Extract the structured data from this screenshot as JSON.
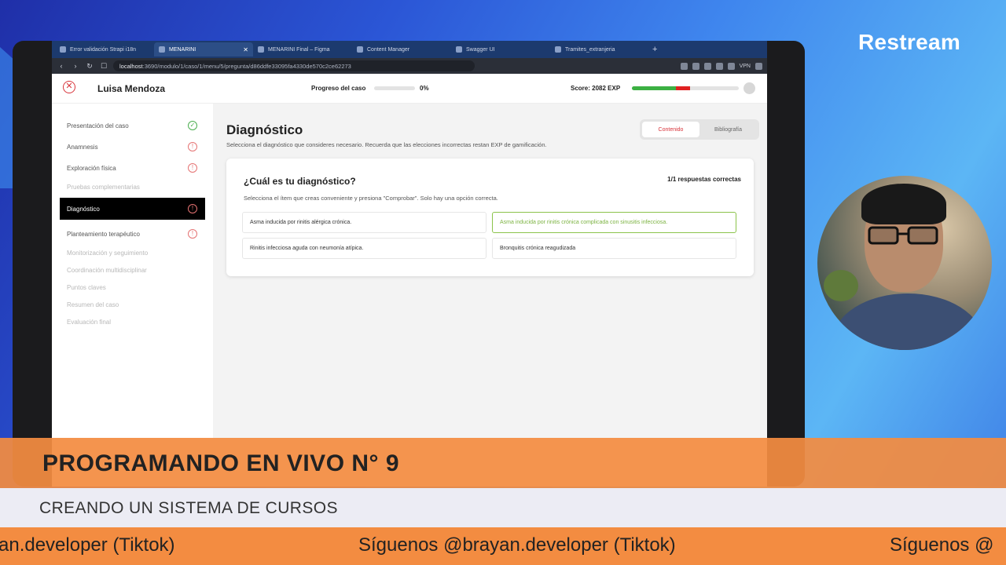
{
  "brand": "Restream",
  "browser": {
    "tabs": [
      {
        "label": "Error validación Strapi i18n"
      },
      {
        "label": "MENARINI"
      },
      {
        "label": "MENARINI Final – Figma"
      },
      {
        "label": "Content Manager"
      },
      {
        "label": "Swagger UI"
      },
      {
        "label": "Tramites_extranjeria"
      }
    ],
    "url_host": "localhost",
    "url_path": ":3690/modulo/1/caso/1/menu/5/pregunta/d86ddfe33095fa4330de570c2ce62273",
    "vpn": "VPN"
  },
  "header": {
    "patient_name": "Luisa Mendoza",
    "progress_label": "Progreso del caso",
    "progress_value": "0%",
    "progress_fraction": 0,
    "score_label": "Score: 2082 EXP"
  },
  "sidebar": {
    "items": [
      {
        "label": "Presentación del caso",
        "status": "✓"
      },
      {
        "label": "Anamnesis",
        "status": "!"
      },
      {
        "label": "Exploración física",
        "status": "!"
      },
      {
        "label": "Pruebas complementarias",
        "status": ""
      },
      {
        "label": "Diagnóstico",
        "status": "!"
      },
      {
        "label": "Planteamiento terapéutico",
        "status": "!"
      },
      {
        "label": "Monitorización y seguimiento",
        "status": ""
      },
      {
        "label": "Coordinación multidisciplinar",
        "status": ""
      },
      {
        "label": "Puntos claves",
        "status": ""
      },
      {
        "label": "Resumen del caso",
        "status": ""
      },
      {
        "label": "Evaluación final",
        "status": ""
      }
    ]
  },
  "main": {
    "title": "Diagnóstico",
    "subtitle": "Selecciona el diagnóstico que consideres necesario. Recuerda que las elecciones incorrectas restan EXP de gamificación.",
    "tabs": [
      "Contenido",
      "Bibliografía"
    ],
    "question": {
      "title": "¿Cuál es tu diagnóstico?",
      "count": "1/1 respuestas correctas",
      "help": "Selecciona el ítem que creas conveniente y presiona \"Comprobar\". Solo hay una opción correcta.",
      "options": [
        "Asma inducida por rinitis alérgica crónica.",
        "Asma inducida por rinitis crónica complicada con sinusitis infecciosa.",
        "Rinitis infecciosa aguda con neumonía atípica.",
        "Bronquitis crónica reagudizada"
      ]
    }
  },
  "overlay": {
    "headline": "PROGRAMANDO EN VIVO N° 9",
    "subline": "CREANDO UN SISTEMA DE CURSOS",
    "ticker_left": "an.developer (Tiktok)",
    "ticker_mid": "Síguenos @brayan.developer (Tiktok)",
    "ticker_right": "Síguenos @"
  },
  "colors": {
    "accent": "#d8343b",
    "correct": "#7cb342",
    "overlay_orange": "#f38c41"
  }
}
